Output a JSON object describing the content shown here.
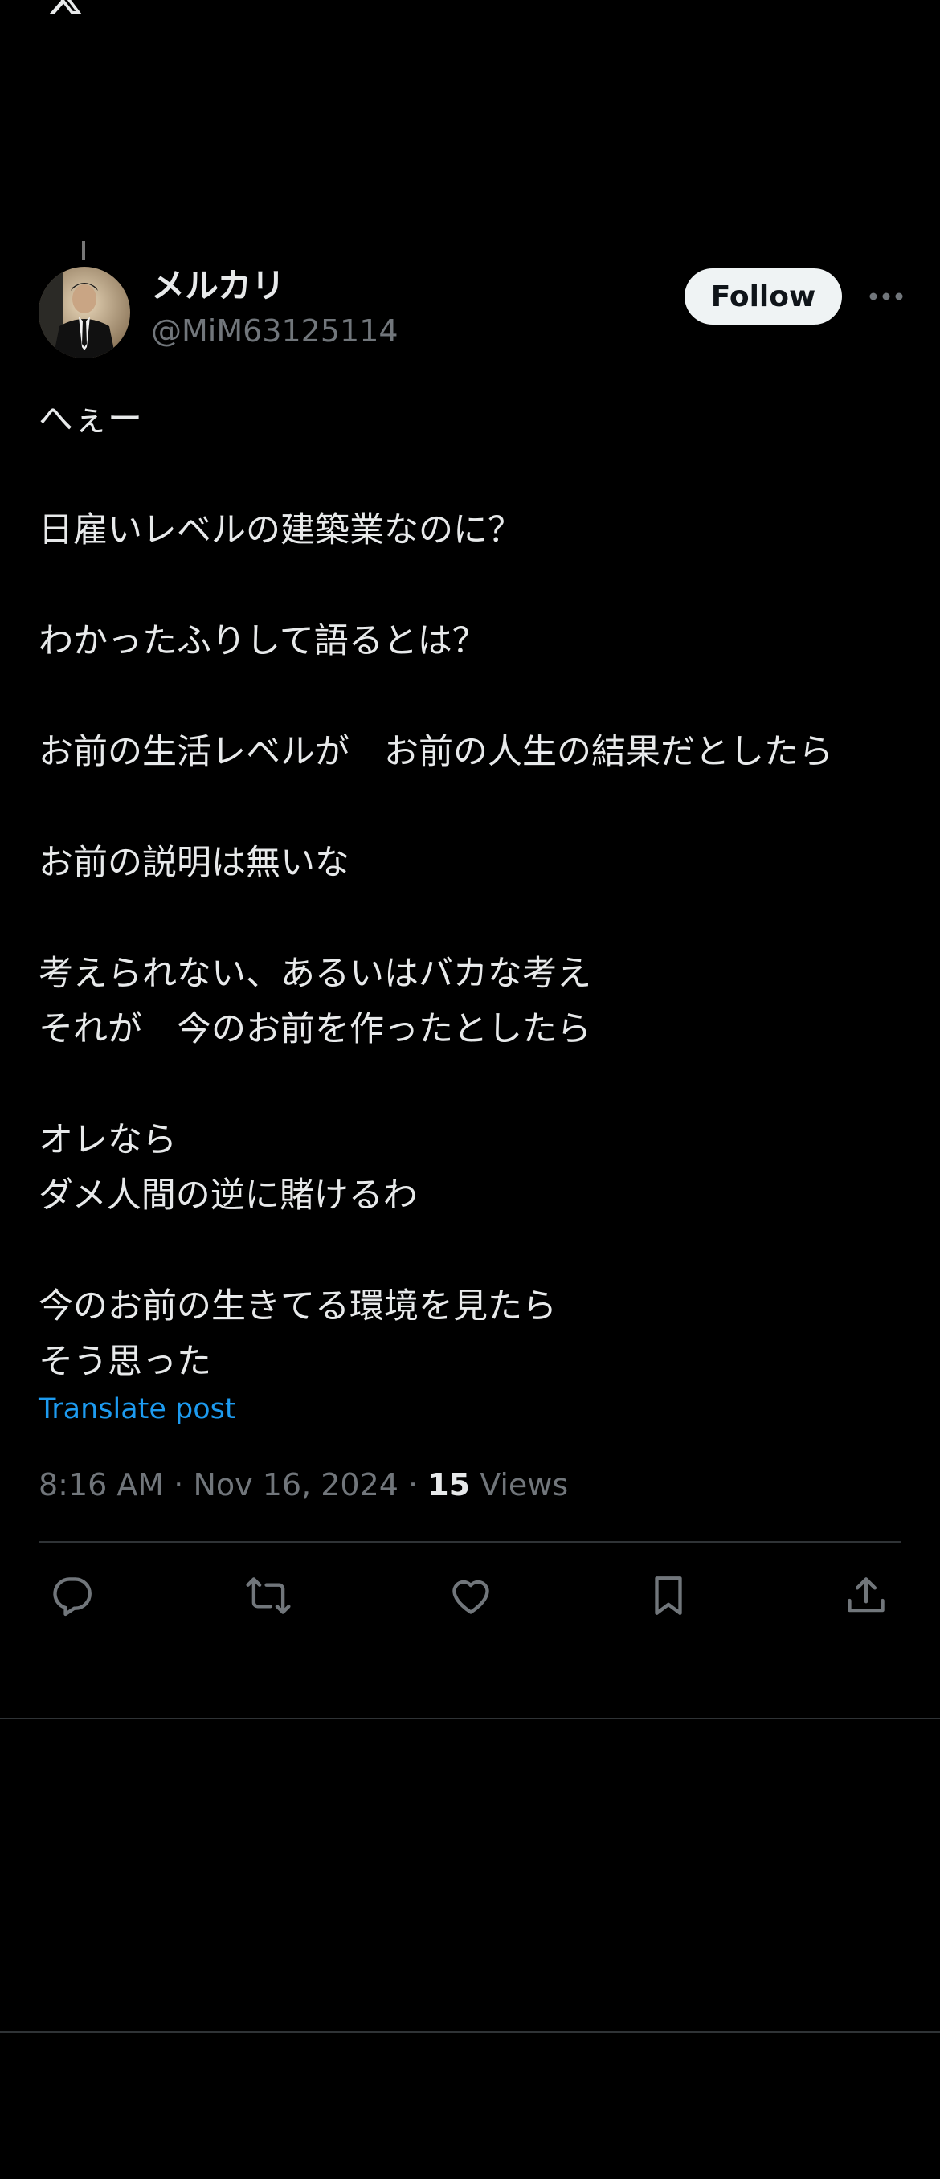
{
  "post": {
    "author": {
      "display_name": "メルカリ",
      "handle": "@MiM63125114"
    },
    "follow_label": "Follow",
    "text": "へぇー\n\n日雇いレベルの建築業なのに？\n\nわかったふりして語るとは？\n\nお前の生活レベルが　お前の人生の結果だとしたら\n\nお前の説明は無いな\n\n考えられない、あるいはバカな考え\nそれが　今のお前を作ったとしたら\n\nオレなら\nダメ人間の逆に賭けるわ\n\n今のお前の生きてる環境を見たら\nそう思った",
    "translate_label": "Translate post",
    "time": "8:16 AM",
    "date": "Nov 16, 2024",
    "views_count": "15",
    "views_label": "Views"
  },
  "icons": {
    "logo": "x-logo-icon",
    "more": "more-dots-icon",
    "reply": "reply-icon",
    "repost": "repost-icon",
    "like": "heart-icon",
    "bookmark": "bookmark-icon",
    "share": "share-icon"
  },
  "colors": {
    "background": "#000000",
    "text": "#e7e9ea",
    "secondary": "#71767b",
    "link": "#1d9bf0",
    "divider": "#2f3336",
    "follow_bg": "#eff3f4"
  }
}
